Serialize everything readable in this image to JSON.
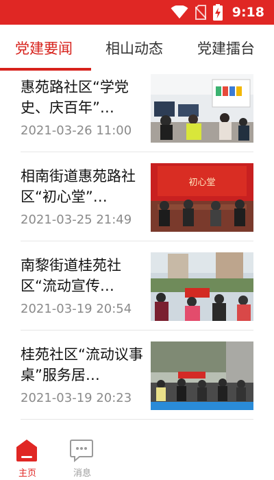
{
  "status_bar": {
    "time": "9:18",
    "icons": [
      "wifi-icon",
      "no-sim-icon",
      "battery-charging-icon"
    ]
  },
  "tabs": [
    {
      "label": "党建要闻",
      "active": true
    },
    {
      "label": "相山动态",
      "active": false
    },
    {
      "label": "党建擂台",
      "active": false
    }
  ],
  "news": [
    {
      "title": "惠苑路社区“学党史、庆百年”…",
      "date": "2021-03-26 11:00"
    },
    {
      "title": "相南街道惠苑路社区“初心堂”…",
      "date": "2021-03-25 21:49"
    },
    {
      "title": "南黎街道桂苑社区“流动宣传…",
      "date": "2021-03-19 20:54"
    },
    {
      "title": " 桂苑社区“流动议事桌”服务居…",
      "date": "2021-03-19 20:23"
    }
  ],
  "thumbnail_banner_text": "初心堂",
  "bottom_nav": [
    {
      "label": "主页",
      "icon": "home-icon",
      "active": true
    },
    {
      "label": "消息",
      "icon": "message-icon",
      "active": false
    }
  ],
  "colors": {
    "brand_red": "#e02724",
    "active_red": "#d7221c",
    "date_gray": "#8a8a8a",
    "inactive_gray": "#9a9a9a"
  }
}
